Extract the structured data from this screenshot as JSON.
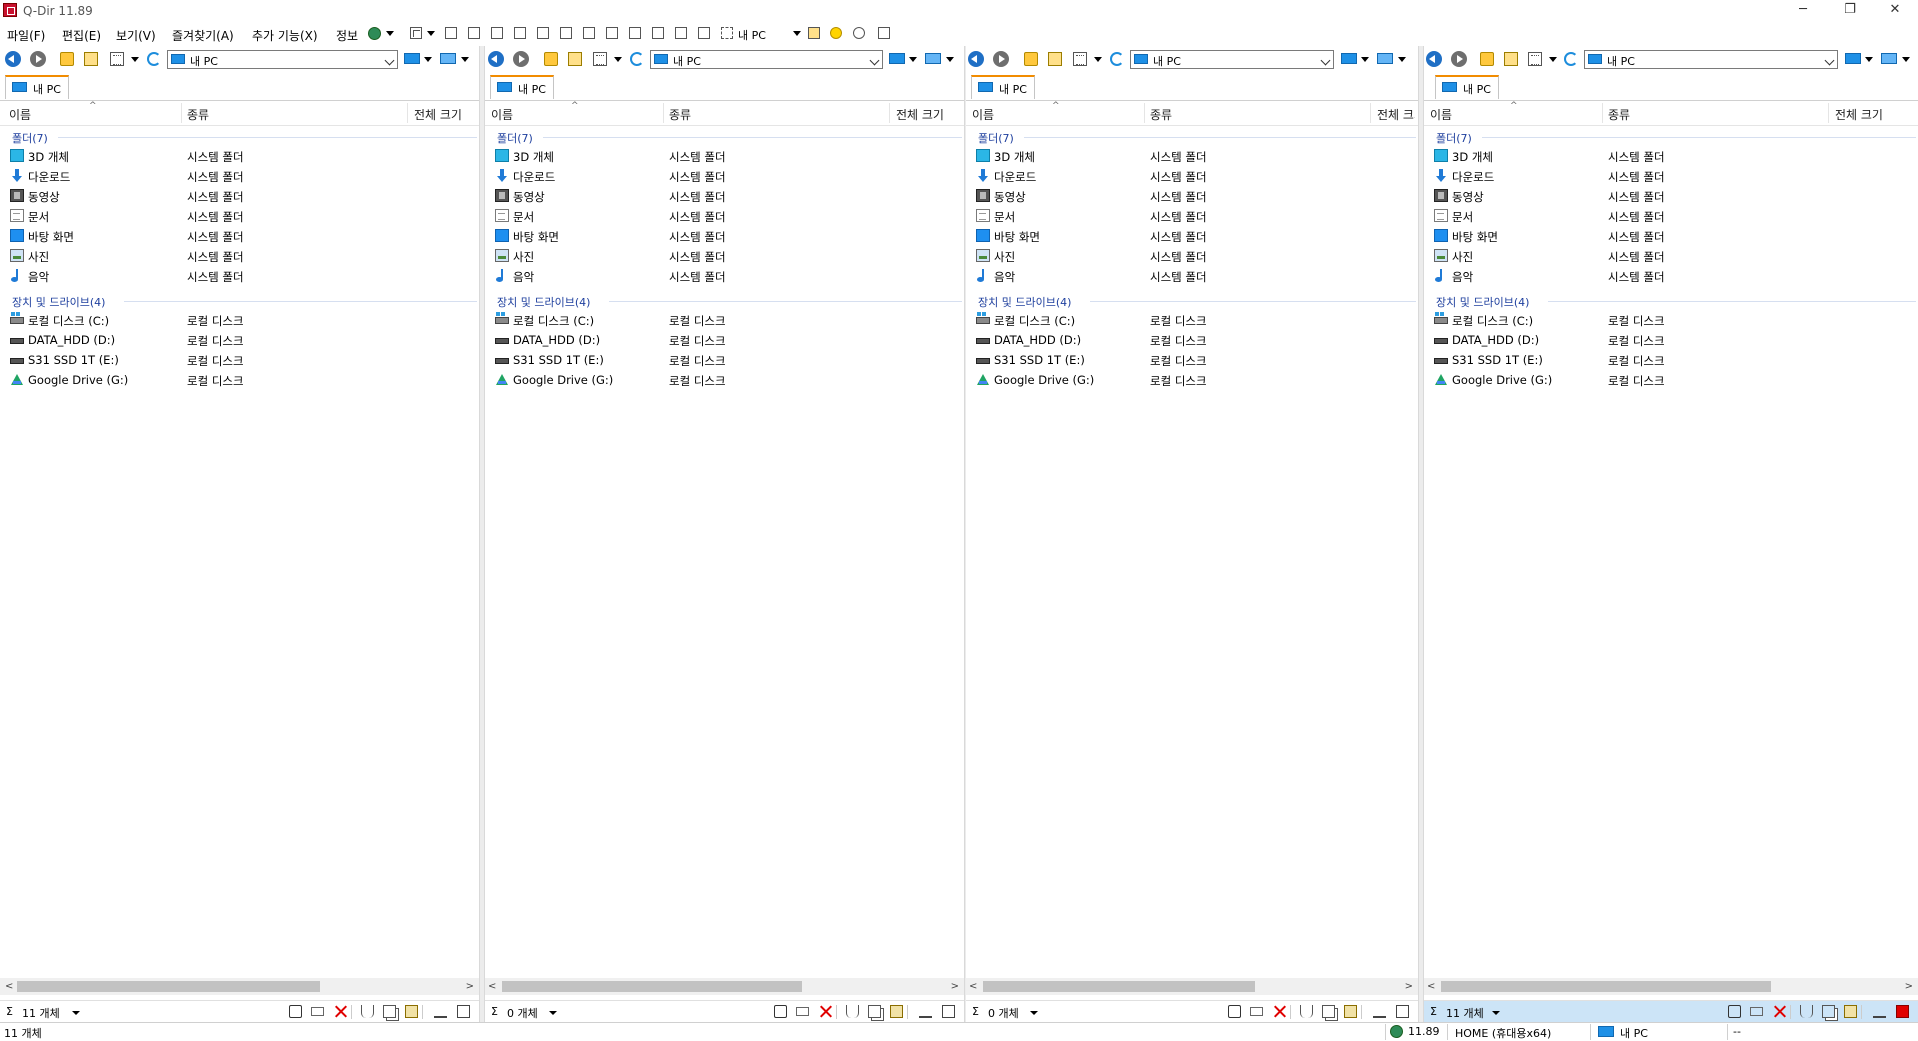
{
  "window": {
    "title": "Q-Dir 11.89",
    "controls": {
      "minimize": "─",
      "restore": "❐",
      "close": "✕"
    }
  },
  "menu": {
    "items": [
      "파일(F)",
      "편집(E)",
      "보기(V)",
      "즐겨찾기(A)",
      "추가 기능(X)",
      "정보"
    ],
    "location_label": "내 PC"
  },
  "pane_common": {
    "address": "내 PC",
    "tab_label": "내 PC",
    "columns": {
      "name": "이름",
      "type": "종류",
      "size": "전체 크기"
    },
    "groups": {
      "folders": "폴더(7)",
      "drives": "장치 및 드라이브(4)"
    },
    "folders": [
      {
        "name": "3D 개체",
        "type": "시스템 폴더",
        "icon": "cube-3d-icon"
      },
      {
        "name": "다운로드",
        "type": "시스템 폴더",
        "icon": "download-arrow-icon"
      },
      {
        "name": "동영상",
        "type": "시스템 폴더",
        "icon": "video-film-icon"
      },
      {
        "name": "문서",
        "type": "시스템 폴더",
        "icon": "document-icon"
      },
      {
        "name": "바탕 화면",
        "type": "시스템 폴더",
        "icon": "desktop-icon"
      },
      {
        "name": "사진",
        "type": "시스템 폴더",
        "icon": "picture-icon"
      },
      {
        "name": "음악",
        "type": "시스템 폴더",
        "icon": "music-note-icon"
      }
    ],
    "drives": [
      {
        "name": "로컬 디스크 (C:)",
        "type": "로컬 디스크",
        "icon": "system-drive-icon"
      },
      {
        "name": "DATA_HDD (D:)",
        "type": "로컬 디스크",
        "icon": "hard-drive-icon"
      },
      {
        "name": "S31 SSD 1T (E:)",
        "type": "로컬 디스크",
        "icon": "hard-drive-icon"
      },
      {
        "name": "Google Drive (G:)",
        "type": "로컬 디스크",
        "icon": "google-drive-icon"
      }
    ]
  },
  "panes": [
    {
      "count": "11 개체",
      "active": false
    },
    {
      "count": "0 개체",
      "active": false
    },
    {
      "count": "0 개체",
      "active": false
    },
    {
      "count": "11 개체",
      "active": true
    }
  ],
  "status": {
    "left": "11 개체",
    "version": "11.89",
    "edition": "HOME (휴대용x64)",
    "location": "내 PC",
    "right": "--"
  },
  "colors": {
    "tab_accent": "#f28c00",
    "group_text": "#1e3f9e",
    "active_footer": "#cce4f7",
    "delete_red": "#e00000"
  }
}
